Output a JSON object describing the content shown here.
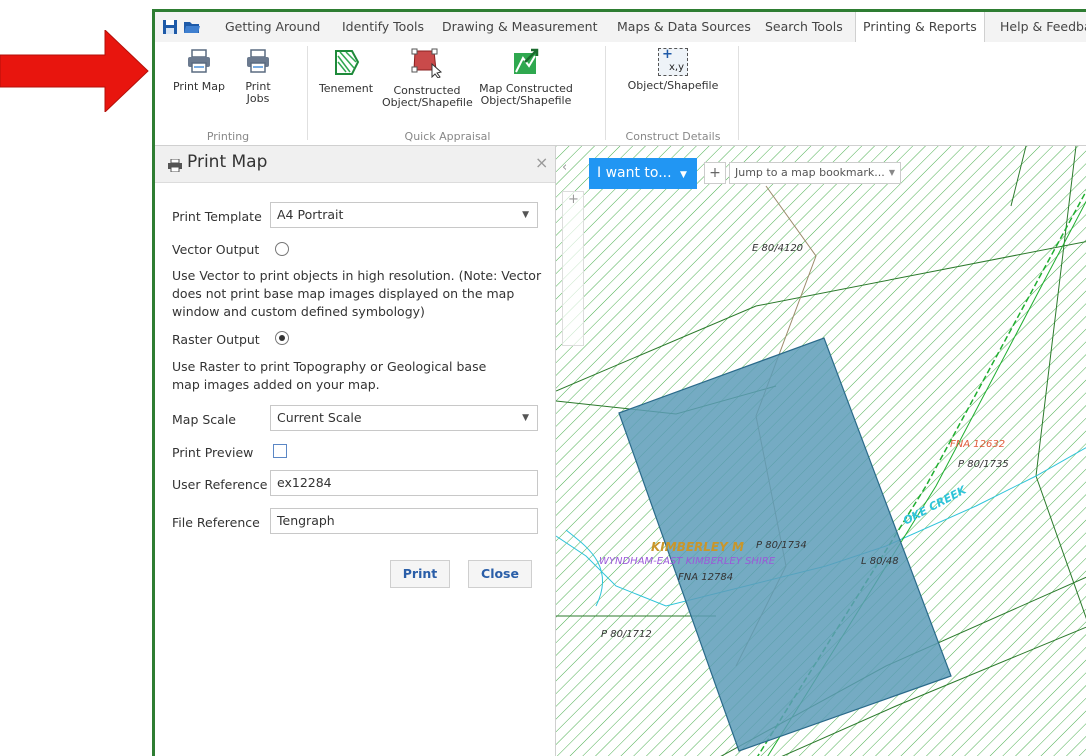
{
  "colors": {
    "accent": "#2196f3",
    "frame": "#2e7d32",
    "arrow": "#e8150e",
    "parcel_fill": "#5d9cb8",
    "hatch": "#4caf50"
  },
  "tabs": [
    "Getting Around",
    "Identify Tools",
    "Drawing & Measurement",
    "Maps & Data Sources",
    "Search Tools",
    "Printing & Reports",
    "Help & Feedba"
  ],
  "ribbon": {
    "print_map": "Print Map",
    "print_jobs": "Print\nJobs",
    "tenement": "Tenement",
    "constructed_shapefile": "Constructed\nObject/Shapefile",
    "map_constructed_shapefile": "Map Constructed\nObject/Shapefile",
    "object_shapefile": "Object/Shapefile",
    "group_printing": "Printing",
    "group_quick": "Quick Appraisal",
    "group_construct": "Construct Details",
    "xy_icon_text": "x,y"
  },
  "panel": {
    "title": "Print Map",
    "close": "×",
    "print_template_label": "Print Template",
    "print_template_value": "A4 Portrait",
    "vector_label": "Vector Output",
    "vector_note": "Use Vector to print objects in high resolution. (Note: Vector does not print base map images displayed on the map window and custom defined symbology)",
    "raster_label": "Raster Output",
    "raster_note": "Use Raster to print Topography or Geological base map images added on your map.",
    "map_scale_label": "Map Scale",
    "map_scale_value": "Current Scale",
    "print_preview_label": "Print Preview",
    "user_ref_label": "User Reference",
    "user_ref_value": "ex12284",
    "file_ref_label": "File Reference",
    "file_ref_value": "Tengraph",
    "print_button": "Print",
    "close_button": "Close"
  },
  "map": {
    "i_want_to": "I want to...",
    "bookmark": "Jump to a map bookmark...",
    "plus": "+",
    "labels": {
      "e": "E 80/4120",
      "fna1": "FNA 12632",
      "p1735": "P 80/1735",
      "creek": "OKE CREEK",
      "kimberley": "KIMBERLEY M",
      "p1734": "P 80/1734",
      "wyndham": "WYNDHAM-EAST KIMBERLEY SHIRE",
      "l80": "L 80/48",
      "fna2": "FNA 12784",
      "p1712": "P 80/1712"
    }
  }
}
